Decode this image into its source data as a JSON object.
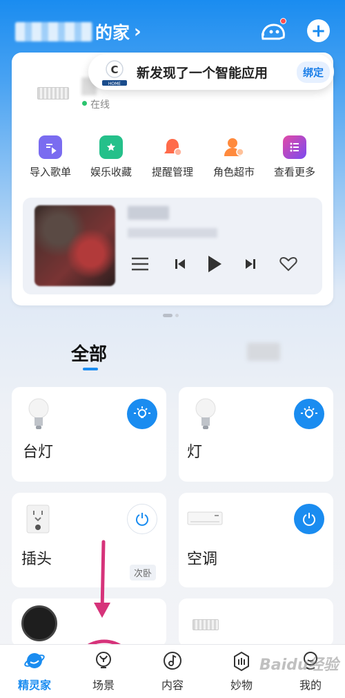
{
  "header": {
    "home_suffix": "的家",
    "chevron": "›",
    "add_symbol": "+"
  },
  "device": {
    "status": "在线"
  },
  "discover": {
    "message": "新发现了一个智能应用",
    "bind_label": "绑定",
    "logo_text": "C",
    "logo_caption": "HOME"
  },
  "quick_actions": [
    {
      "label": "导入歌单",
      "color": "#7a6cf0"
    },
    {
      "label": "娱乐收藏",
      "color": "#25c08a"
    },
    {
      "label": "提醒管理",
      "color": "#ff6b4a"
    },
    {
      "label": "角色超市",
      "color": "#ff8a3d"
    },
    {
      "label": "查看更多",
      "color": "#b04ee8"
    }
  ],
  "tabs": {
    "all": "全部"
  },
  "devices": [
    {
      "name": "台灯",
      "power": "on"
    },
    {
      "name": "灯",
      "power": "on"
    },
    {
      "name": "插头",
      "power": "off",
      "room": "次卧"
    },
    {
      "name": "空调",
      "power": "on"
    }
  ],
  "nav": {
    "items": [
      {
        "label": "精灵家",
        "active": true
      },
      {
        "label": "场景",
        "active": false
      },
      {
        "label": "内容",
        "active": false
      },
      {
        "label": "妙物",
        "active": false
      },
      {
        "label": "我的",
        "active": false
      }
    ]
  },
  "colors": {
    "accent": "#1a8cf0",
    "annotation": "#d6337a"
  },
  "watermark": "Baidu经验"
}
